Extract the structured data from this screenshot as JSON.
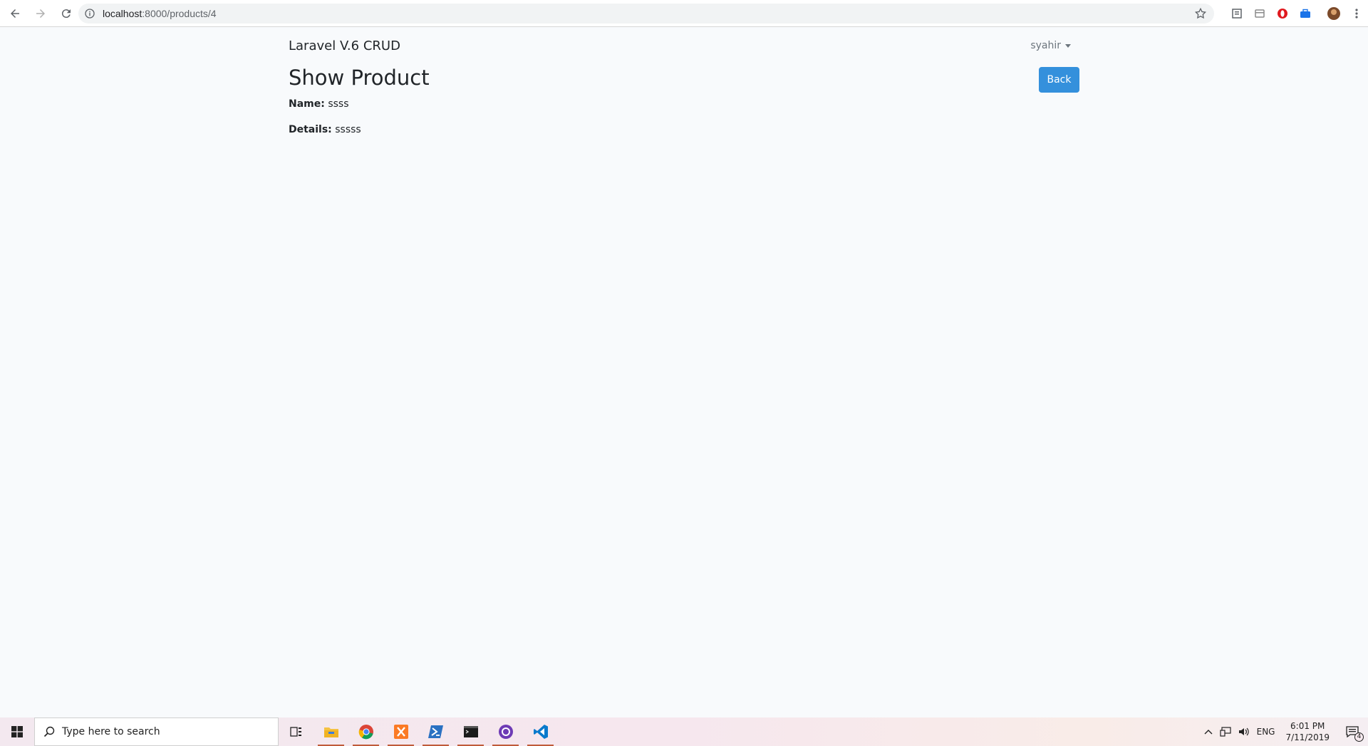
{
  "browser": {
    "url_host": "localhost",
    "url_path": ":8000/products/4"
  },
  "navbar": {
    "brand": "Laravel V.6 CRUD",
    "user": "syahir"
  },
  "page": {
    "title": "Show Product",
    "back_label": "Back",
    "fields": [
      {
        "label": "Name:",
        "value": "ssss"
      },
      {
        "label": "Details:",
        "value": "sssss"
      }
    ]
  },
  "taskbar": {
    "search_placeholder": "Type here to search",
    "language": "ENG",
    "time": "6:01 PM",
    "date": "7/11/2019",
    "notification_count": "4"
  },
  "colors": {
    "primary": "#3490dc",
    "page_bg": "#f8fafc"
  }
}
